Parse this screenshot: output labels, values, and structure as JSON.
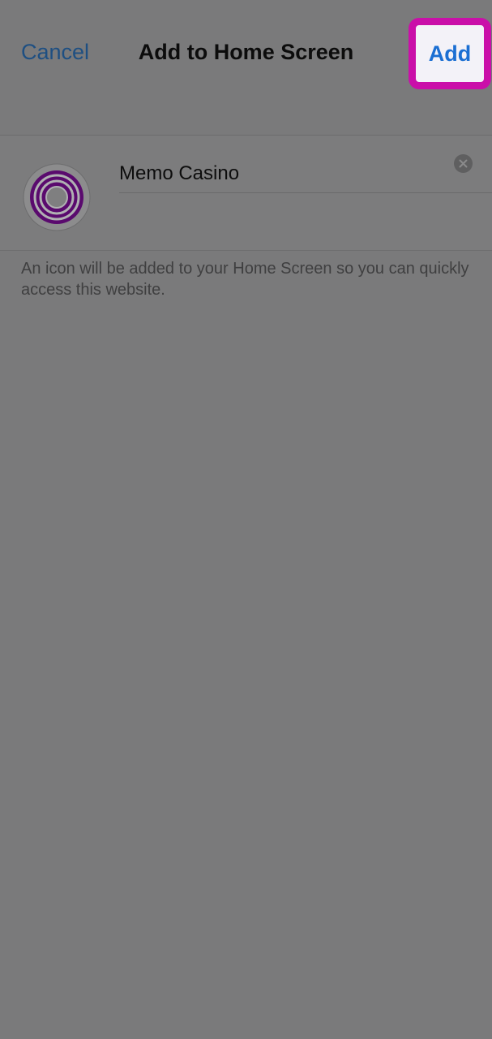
{
  "nav": {
    "cancel_label": "Cancel",
    "title": "Add to Home Screen",
    "add_label": "Add"
  },
  "form": {
    "icon": "target-rings-icon",
    "name_value": "Memo Casino",
    "url_value": "",
    "clear_icon": "clear-x-icon"
  },
  "footer": {
    "note": "An icon will be added to your Home Screen so you can quickly access this website."
  },
  "colors": {
    "background": "#7a7a7b",
    "link": "#1e4f82",
    "add_text": "#1b6fd3",
    "highlight_border": "#ca0fa9",
    "icon_purple": "#5a0a6e"
  }
}
